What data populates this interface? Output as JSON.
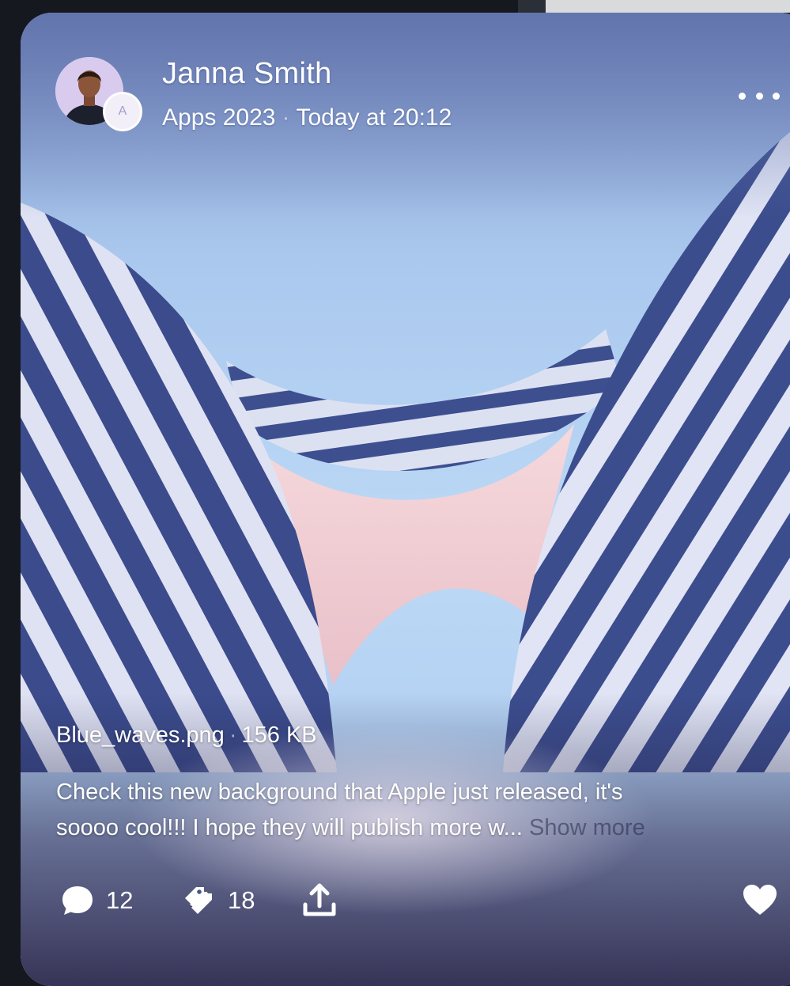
{
  "post": {
    "author": "Janna Smith",
    "badge_letter": "A",
    "channel": "Apps 2023",
    "separator": "·",
    "time": "Today at 20:12",
    "file_name": "Blue_waves.png",
    "file_size": "156 KB",
    "caption_line1": "Check this new background that Apple just released, it's",
    "caption_line2": "soooo cool!!! I hope they will publish more w...",
    "show_more": "Show more",
    "comments_count": "12",
    "tags_count": "18"
  },
  "icons": {
    "more": "more-horizontal-icon",
    "comment": "speech-bubble-icon",
    "tag": "tags-icon",
    "share": "share-upload-icon",
    "like": "heart-icon"
  },
  "colors": {
    "sky": "#b9d7f4",
    "stripe_dark": "#3d4f8e",
    "stripe_light": "#dfe2f2",
    "bridge": "#f0cfd4",
    "text": "#ffffff"
  }
}
